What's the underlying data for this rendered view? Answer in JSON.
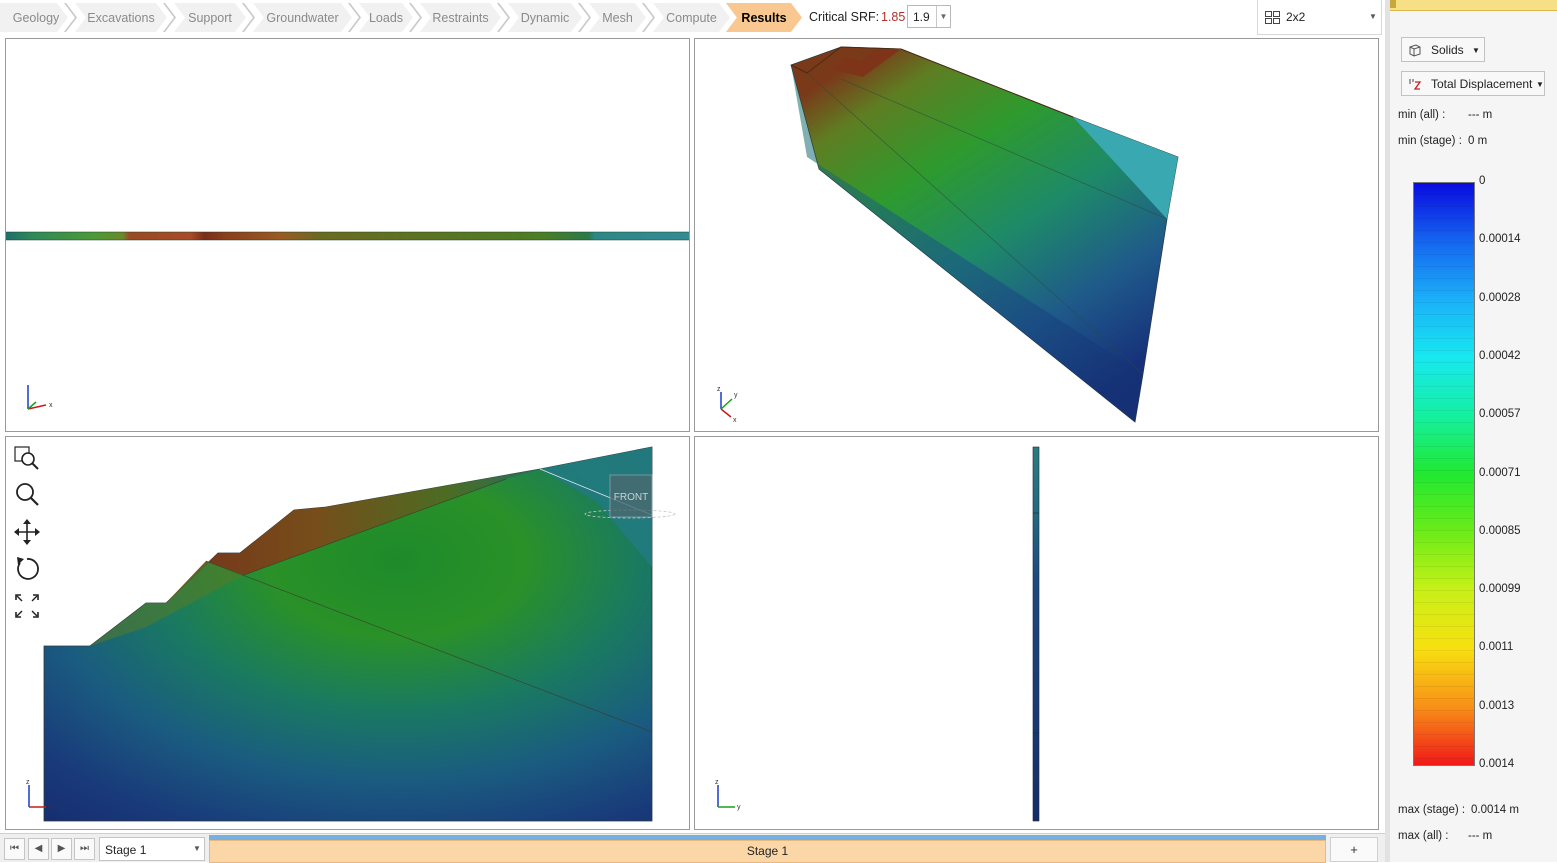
{
  "workflow": {
    "tabs": [
      {
        "label": "Geology"
      },
      {
        "label": "Excavations"
      },
      {
        "label": "Support"
      },
      {
        "label": "Groundwater"
      },
      {
        "label": "Loads"
      },
      {
        "label": "Restraints"
      },
      {
        "label": "Dynamic"
      },
      {
        "label": "Mesh"
      },
      {
        "label": "Compute"
      },
      {
        "label": "Results"
      }
    ],
    "active_tab": "Results"
  },
  "srf": {
    "label": "Critical SRF:",
    "value": "1.85",
    "selected": "1.9"
  },
  "layout": {
    "label": "2x2",
    "icon": "grid-layout-icon"
  },
  "viewports": {
    "top_left": {
      "axis_labels": [
        "x"
      ],
      "view": "top"
    },
    "top_right": {
      "axis_labels": [
        "z",
        "x",
        "y"
      ],
      "view": "perspective"
    },
    "bottom_left": {
      "axis_labels": [
        "z",
        "x"
      ],
      "view": "front",
      "view_cube_label": "FRONT"
    },
    "bottom_right": {
      "axis_labels": [
        "z",
        "y"
      ],
      "view": "side"
    }
  },
  "tools": [
    {
      "name": "zoom-window-icon"
    },
    {
      "name": "zoom-icon"
    },
    {
      "name": "pan-icon"
    },
    {
      "name": "rotate-icon"
    },
    {
      "name": "zoom-extents-icon"
    }
  ],
  "stage_bar": {
    "nav": [
      "first-stage-icon",
      "prev-stage-icon",
      "next-stage-icon",
      "last-stage-icon"
    ],
    "selected_stage": "Stage 1",
    "stage_tab": "Stage 1",
    "add_label": "+"
  },
  "panel": {
    "render_mode": "Solids",
    "result_type": "Total Displacement",
    "min_all_label": "min (all) :",
    "min_all_value": "--- m",
    "min_stage_label": "min (stage) :",
    "min_stage_value": "0 m",
    "max_stage_label": "max (stage) :",
    "max_stage_value": "0.0014 m",
    "max_all_label": "max (all) :",
    "max_all_value": "--- m",
    "legend": {
      "ticks": [
        "0",
        "0.00014",
        "0.00028",
        "0.00042",
        "0.00057",
        "0.00071",
        "0.00085",
        "0.00099",
        "0.0011",
        "0.0013",
        "0.0014"
      ],
      "colors": [
        "#0a0ae0",
        "#1565f0",
        "#1ab0f8",
        "#18e8f0",
        "#14f0a0",
        "#20e830",
        "#6cec18",
        "#c8f018",
        "#f8e010",
        "#f89018",
        "#f01818"
      ]
    }
  }
}
